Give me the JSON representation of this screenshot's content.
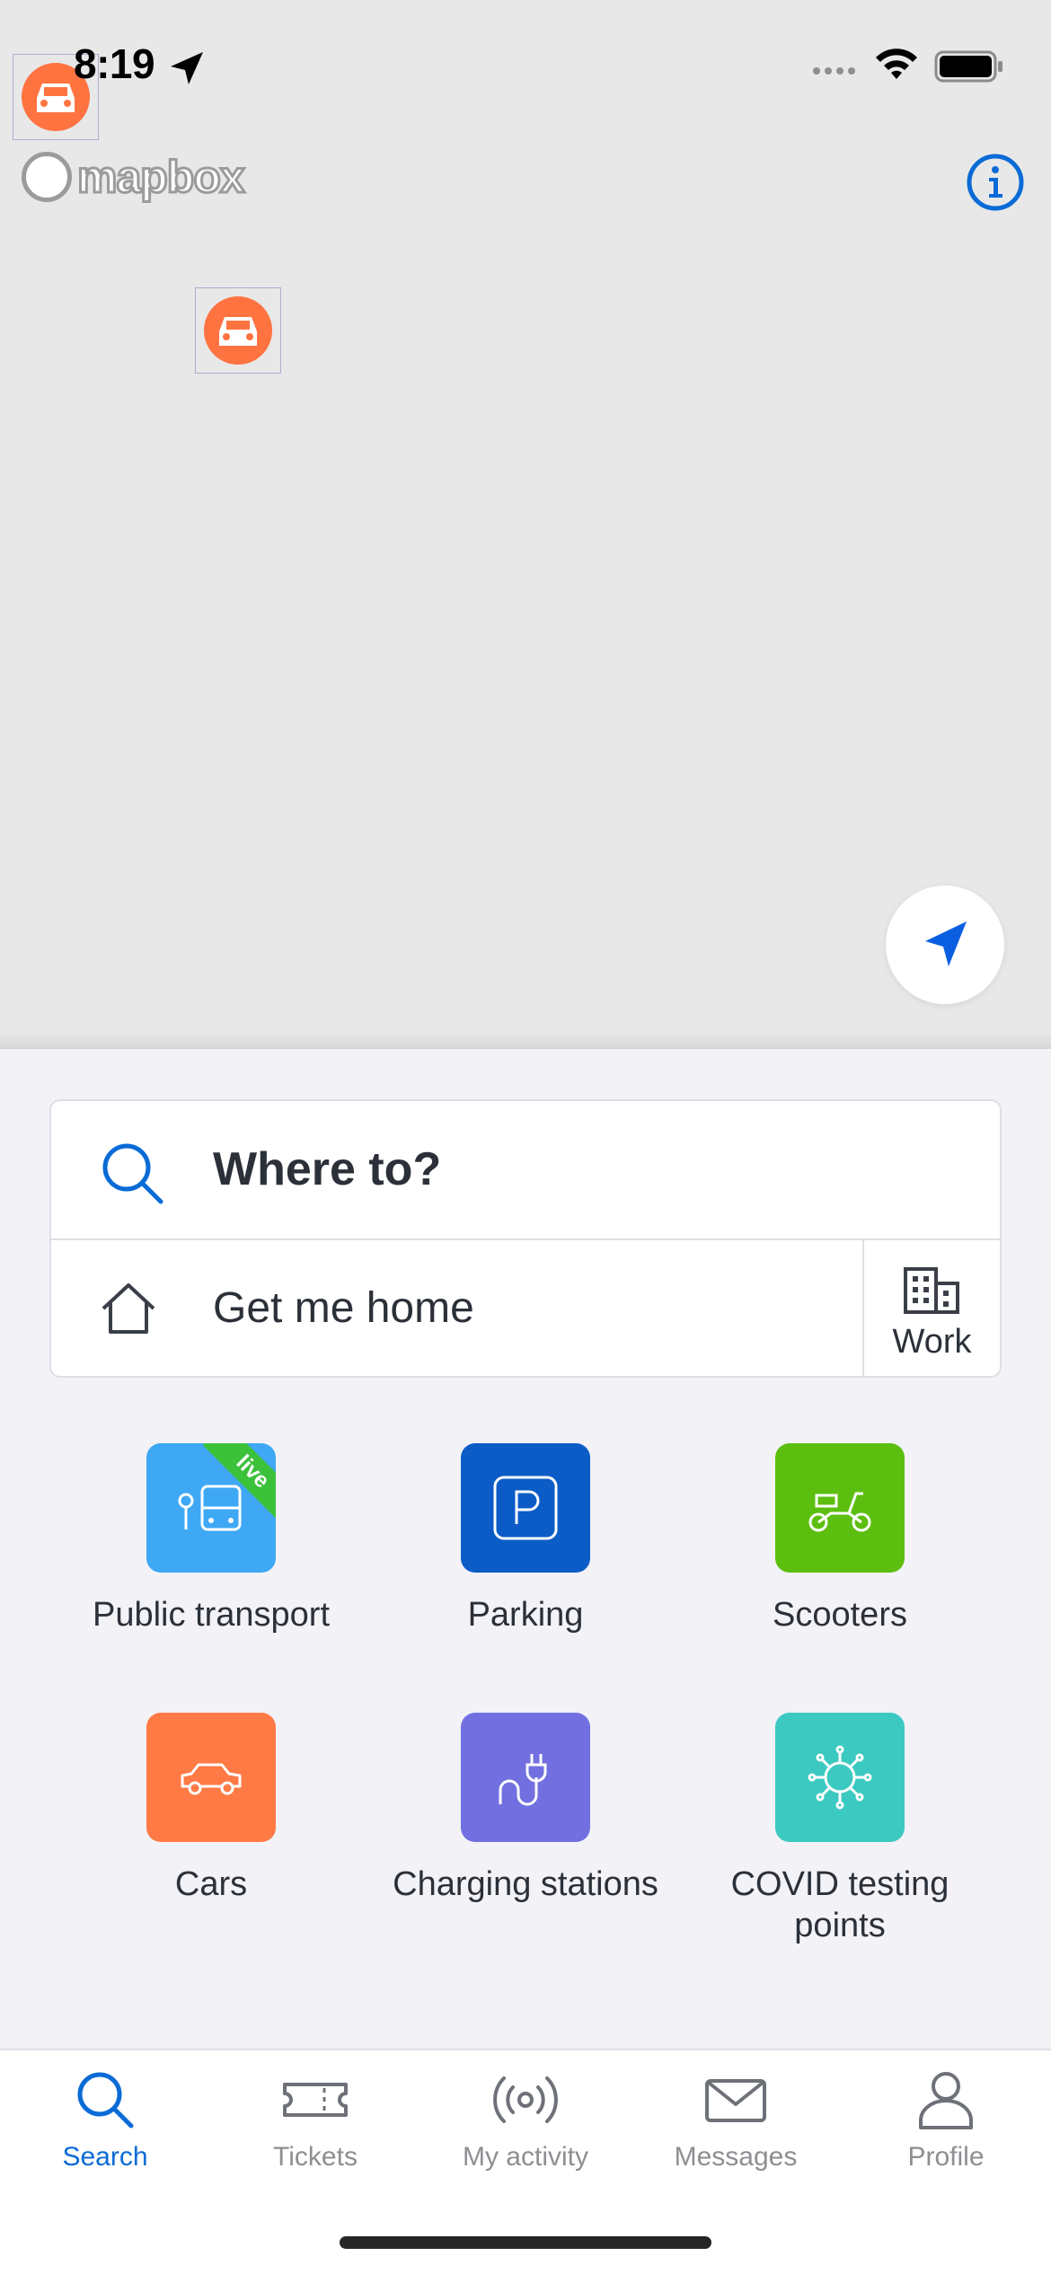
{
  "status_bar": {
    "time": "8:19"
  },
  "map": {
    "attribution_logo": "mapbox",
    "markers": [
      {
        "type": "car-icon"
      },
      {
        "type": "car-icon"
      }
    ],
    "colors": {
      "marker": "#ff7340",
      "accent": "#0a6bd6"
    }
  },
  "search": {
    "placeholder": "Where to?",
    "home_label": "Get me home",
    "work_label": "Work"
  },
  "categories": [
    {
      "label": "Public transport",
      "color": "#3ea8f4",
      "icon": "bus-icon",
      "badge": "live"
    },
    {
      "label": "Parking",
      "color": "#0b5cc7",
      "icon": "parking-icon"
    },
    {
      "label": "Scooters",
      "color": "#5cbf10",
      "icon": "scooter-icon"
    },
    {
      "label": "Cars",
      "color": "#ff7a45",
      "icon": "car-icon"
    },
    {
      "label": "Charging stations",
      "color": "#7270e0",
      "icon": "plug-icon"
    },
    {
      "label": "COVID testing points",
      "color": "#3cc9c1",
      "icon": "virus-icon"
    }
  ],
  "tabs": [
    {
      "label": "Search",
      "icon": "search-icon",
      "active": true
    },
    {
      "label": "Tickets",
      "icon": "ticket-icon"
    },
    {
      "label": "My activity",
      "icon": "activity-icon"
    },
    {
      "label": "Messages",
      "icon": "envelope-icon"
    },
    {
      "label": "Profile",
      "icon": "person-icon"
    }
  ]
}
